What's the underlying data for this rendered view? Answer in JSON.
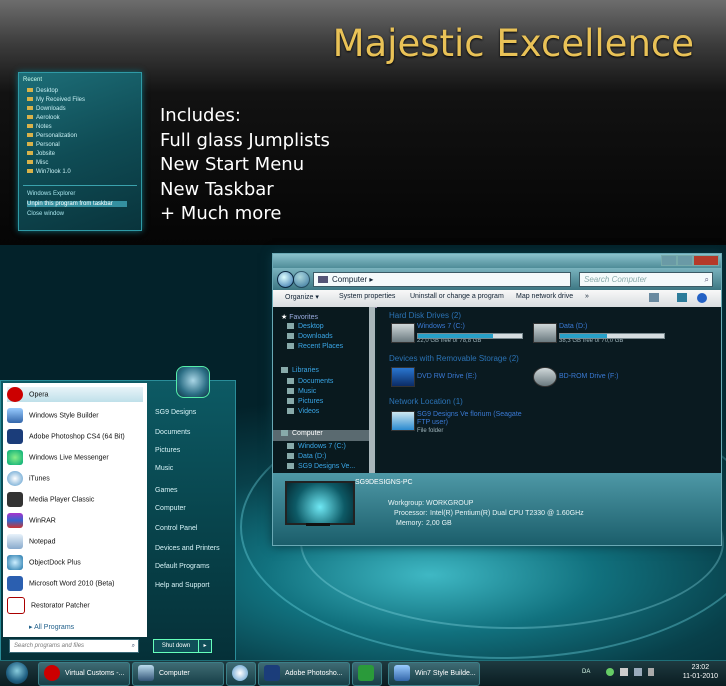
{
  "banner": {
    "brand": "Majestic Excellence",
    "includes": [
      "Includes:",
      "Full glass Jumplists",
      "New Start Menu",
      "New Taskbar",
      "+ Much more"
    ],
    "jumplist": {
      "header": "Recent",
      "items": [
        "Desktop",
        "My Received Files",
        "Downloads",
        "Aerolook",
        "Notes",
        "Personalization",
        "Personal",
        "Jobsite",
        "Misc",
        "Win7look 1.0"
      ],
      "tasks": [
        "Windows Explorer",
        "Unpin this program from taskbar",
        "Close window"
      ]
    }
  },
  "explorer": {
    "address": "Computer",
    "search_placeholder": "Search Computer",
    "toolbar": [
      "Organize ▾",
      "System properties",
      "Uninstall or change a program",
      "Map network drive",
      "»"
    ],
    "nav": {
      "favorites": "Favorites",
      "fav_items": [
        "Desktop",
        "Downloads",
        "Recent Places"
      ],
      "libraries": "Libraries",
      "lib_items": [
        "Documents",
        "Music",
        "Pictures",
        "Videos"
      ],
      "computer": "Computer",
      "comp_items": [
        "Windows 7 (C:)",
        "Data (D:)",
        "SG9 Designs Ve..."
      ]
    },
    "groups": {
      "hdd": "Hard Disk Drives (2)",
      "removable": "Devices with Removable Storage (2)",
      "network": "Network Location (1)"
    },
    "drives": [
      {
        "name": "Windows 7 (C:)",
        "free": "22,0 GB free of 78,8 GB",
        "used_fraction": 0.72
      },
      {
        "name": "Data (D:)",
        "free": "38,3 GB free of 70,0 GB",
        "used_fraction": 0.45
      }
    ],
    "removable": [
      "DVD RW Drive (E:)",
      "BD-ROM Drive (F:)"
    ],
    "network_item": {
      "name": "SG9 Designs Ve florium (Seagate FTP user)",
      "type": "File folder"
    },
    "details": {
      "pc_name": "SG9DESIGNS-PC",
      "workgroup_label": "Workgroup:",
      "workgroup": "WORKGROUP",
      "processor_label": "Processor:",
      "processor": "Intel(R) Pentium(R) Dual  CPU  T2330  @ 1.60GHz",
      "memory_label": "Memory:",
      "memory": "2,00 GB"
    }
  },
  "start_menu": {
    "programs": [
      "Opera",
      "Windows Style Builder",
      "Adobe Photoshop CS4 (64 Bit)",
      "Windows Live Messenger",
      "iTunes",
      "Media Player Classic",
      "WinRAR",
      "Notepad",
      "ObjectDock Plus",
      "Microsoft Word 2010 (Beta)",
      "Restorator Patcher"
    ],
    "all_programs": "All Programs",
    "search_placeholder": "Search programs and files",
    "right": [
      "SG9 Designs",
      "Documents",
      "Pictures",
      "Music",
      "Games",
      "Computer",
      "Control Panel",
      "Devices and Printers",
      "Default Programs",
      "Help and Support"
    ],
    "shutdown": "Shut down"
  },
  "taskbar": {
    "buttons": [
      "Virtual Customs -...",
      "Computer",
      "",
      "Adobe Photosho...",
      "",
      "Win7 Style Builde..."
    ],
    "lang": "DA",
    "time": "23:02",
    "date": "11-01-2010"
  },
  "colors": {
    "brand": "#e9c257",
    "link_blue": "#3a7ad4",
    "teal": "#0d5a64"
  }
}
